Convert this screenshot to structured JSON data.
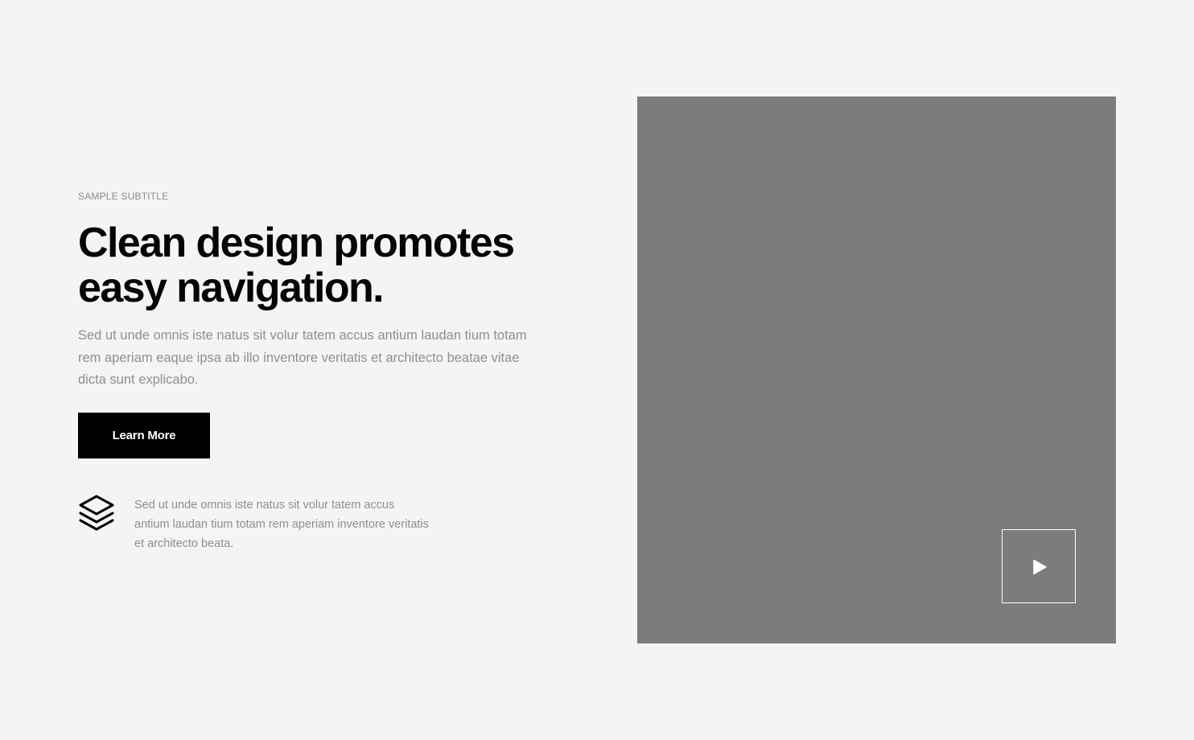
{
  "hero": {
    "subtitle": "SAMPLE SUBTITLE",
    "title_line1": "Clean design promotes",
    "title_line2": "easy navigation.",
    "description": "Sed ut unde omnis iste natus sit volur tatem accus antium laudan tium totam rem aperiam eaque ipsa ab illo inventore veritatis et architecto beatae vitae dicta sunt explicabo.",
    "button_label": "Learn More"
  },
  "feature": {
    "icon": "layers-icon",
    "text": "Sed ut unde omnis iste natus sit volur tatem accus antium laudan tium totam rem aperiam inventore veritatis et architecto beata."
  },
  "media": {
    "placeholder_color": "#7b7c7d",
    "play_icon": "play-icon"
  },
  "colors": {
    "background": "#f4f4f4",
    "heading": "#050505",
    "body_text": "#8f8f8f",
    "button_bg": "#000000",
    "button_text": "#ffffff"
  }
}
